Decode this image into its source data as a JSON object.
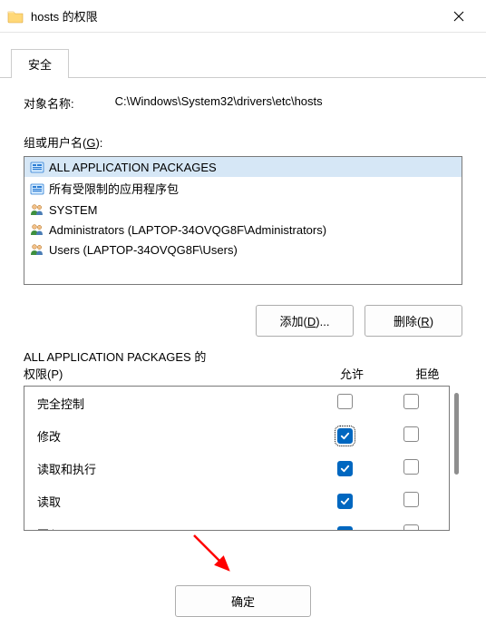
{
  "window": {
    "title": "hosts 的权限"
  },
  "tabs": {
    "security": "安全"
  },
  "object": {
    "label": "对象名称:",
    "value": "C:\\Windows\\System32\\drivers\\etc\\hosts"
  },
  "groups": {
    "label_prefix": "组或用户名(",
    "label_u": "G",
    "label_suffix": "):",
    "items": [
      {
        "name": "ALL APPLICATION PACKAGES",
        "icon": "group",
        "selected": true
      },
      {
        "name": "所有受限制的应用程序包",
        "icon": "group",
        "selected": false
      },
      {
        "name": "SYSTEM",
        "icon": "users",
        "selected": false
      },
      {
        "name": "Administrators (LAPTOP-34OVQG8F\\Administrators)",
        "icon": "users",
        "selected": false
      },
      {
        "name": "Users (LAPTOP-34OVQG8F\\Users)",
        "icon": "users",
        "selected": false
      }
    ]
  },
  "buttons": {
    "add_prefix": "添加(",
    "add_u": "D",
    "add_suffix": ")...",
    "remove_prefix": "删除(",
    "remove_u": "R",
    "remove_suffix": ")",
    "ok": "确定"
  },
  "permissions": {
    "header_prefix": "ALL APPLICATION PACKAGES 的",
    "header_prefix2": "权限(",
    "header_u": "P",
    "header_suffix": ")",
    "allow": "允许",
    "deny": "拒绝",
    "rows": [
      {
        "name": "完全控制",
        "allow": false,
        "deny": false,
        "focused": false
      },
      {
        "name": "修改",
        "allow": true,
        "deny": false,
        "focused": true
      },
      {
        "name": "读取和执行",
        "allow": true,
        "deny": false,
        "focused": false
      },
      {
        "name": "读取",
        "allow": true,
        "deny": false,
        "focused": false
      },
      {
        "name": "写入",
        "allow": true,
        "deny": false,
        "focused": false
      }
    ]
  }
}
